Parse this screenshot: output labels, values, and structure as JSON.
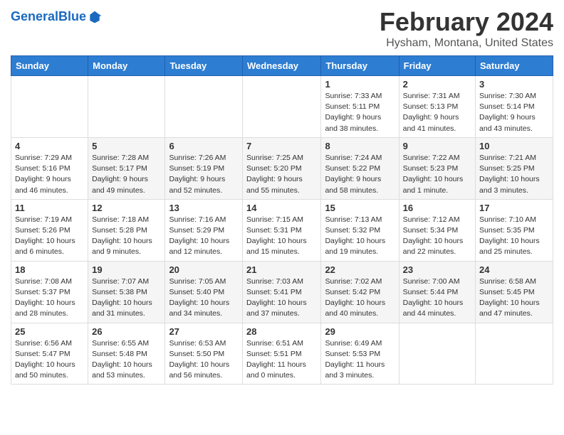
{
  "header": {
    "logo_line1": "General",
    "logo_line2": "Blue",
    "month_year": "February 2024",
    "location": "Hysham, Montana, United States"
  },
  "days_of_week": [
    "Sunday",
    "Monday",
    "Tuesday",
    "Wednesday",
    "Thursday",
    "Friday",
    "Saturday"
  ],
  "weeks": [
    [
      {
        "day": "",
        "info": ""
      },
      {
        "day": "",
        "info": ""
      },
      {
        "day": "",
        "info": ""
      },
      {
        "day": "",
        "info": ""
      },
      {
        "day": "1",
        "info": "Sunrise: 7:33 AM\nSunset: 5:11 PM\nDaylight: 9 hours\nand 38 minutes."
      },
      {
        "day": "2",
        "info": "Sunrise: 7:31 AM\nSunset: 5:13 PM\nDaylight: 9 hours\nand 41 minutes."
      },
      {
        "day": "3",
        "info": "Sunrise: 7:30 AM\nSunset: 5:14 PM\nDaylight: 9 hours\nand 43 minutes."
      }
    ],
    [
      {
        "day": "4",
        "info": "Sunrise: 7:29 AM\nSunset: 5:16 PM\nDaylight: 9 hours\nand 46 minutes."
      },
      {
        "day": "5",
        "info": "Sunrise: 7:28 AM\nSunset: 5:17 PM\nDaylight: 9 hours\nand 49 minutes."
      },
      {
        "day": "6",
        "info": "Sunrise: 7:26 AM\nSunset: 5:19 PM\nDaylight: 9 hours\nand 52 minutes."
      },
      {
        "day": "7",
        "info": "Sunrise: 7:25 AM\nSunset: 5:20 PM\nDaylight: 9 hours\nand 55 minutes."
      },
      {
        "day": "8",
        "info": "Sunrise: 7:24 AM\nSunset: 5:22 PM\nDaylight: 9 hours\nand 58 minutes."
      },
      {
        "day": "9",
        "info": "Sunrise: 7:22 AM\nSunset: 5:23 PM\nDaylight: 10 hours\nand 1 minute."
      },
      {
        "day": "10",
        "info": "Sunrise: 7:21 AM\nSunset: 5:25 PM\nDaylight: 10 hours\nand 3 minutes."
      }
    ],
    [
      {
        "day": "11",
        "info": "Sunrise: 7:19 AM\nSunset: 5:26 PM\nDaylight: 10 hours\nand 6 minutes."
      },
      {
        "day": "12",
        "info": "Sunrise: 7:18 AM\nSunset: 5:28 PM\nDaylight: 10 hours\nand 9 minutes."
      },
      {
        "day": "13",
        "info": "Sunrise: 7:16 AM\nSunset: 5:29 PM\nDaylight: 10 hours\nand 12 minutes."
      },
      {
        "day": "14",
        "info": "Sunrise: 7:15 AM\nSunset: 5:31 PM\nDaylight: 10 hours\nand 15 minutes."
      },
      {
        "day": "15",
        "info": "Sunrise: 7:13 AM\nSunset: 5:32 PM\nDaylight: 10 hours\nand 19 minutes."
      },
      {
        "day": "16",
        "info": "Sunrise: 7:12 AM\nSunset: 5:34 PM\nDaylight: 10 hours\nand 22 minutes."
      },
      {
        "day": "17",
        "info": "Sunrise: 7:10 AM\nSunset: 5:35 PM\nDaylight: 10 hours\nand 25 minutes."
      }
    ],
    [
      {
        "day": "18",
        "info": "Sunrise: 7:08 AM\nSunset: 5:37 PM\nDaylight: 10 hours\nand 28 minutes."
      },
      {
        "day": "19",
        "info": "Sunrise: 7:07 AM\nSunset: 5:38 PM\nDaylight: 10 hours\nand 31 minutes."
      },
      {
        "day": "20",
        "info": "Sunrise: 7:05 AM\nSunset: 5:40 PM\nDaylight: 10 hours\nand 34 minutes."
      },
      {
        "day": "21",
        "info": "Sunrise: 7:03 AM\nSunset: 5:41 PM\nDaylight: 10 hours\nand 37 minutes."
      },
      {
        "day": "22",
        "info": "Sunrise: 7:02 AM\nSunset: 5:42 PM\nDaylight: 10 hours\nand 40 minutes."
      },
      {
        "day": "23",
        "info": "Sunrise: 7:00 AM\nSunset: 5:44 PM\nDaylight: 10 hours\nand 44 minutes."
      },
      {
        "day": "24",
        "info": "Sunrise: 6:58 AM\nSunset: 5:45 PM\nDaylight: 10 hours\nand 47 minutes."
      }
    ],
    [
      {
        "day": "25",
        "info": "Sunrise: 6:56 AM\nSunset: 5:47 PM\nDaylight: 10 hours\nand 50 minutes."
      },
      {
        "day": "26",
        "info": "Sunrise: 6:55 AM\nSunset: 5:48 PM\nDaylight: 10 hours\nand 53 minutes."
      },
      {
        "day": "27",
        "info": "Sunrise: 6:53 AM\nSunset: 5:50 PM\nDaylight: 10 hours\nand 56 minutes."
      },
      {
        "day": "28",
        "info": "Sunrise: 6:51 AM\nSunset: 5:51 PM\nDaylight: 11 hours\nand 0 minutes."
      },
      {
        "day": "29",
        "info": "Sunrise: 6:49 AM\nSunset: 5:53 PM\nDaylight: 11 hours\nand 3 minutes."
      },
      {
        "day": "",
        "info": ""
      },
      {
        "day": "",
        "info": ""
      }
    ]
  ]
}
